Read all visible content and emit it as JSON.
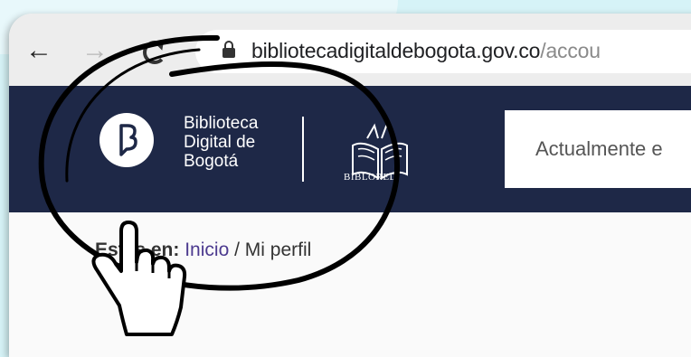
{
  "browser": {
    "url_domain": "bibliotecadigitaldebogota.gov.co",
    "url_path": "/accou"
  },
  "header": {
    "logo_lines": [
      "Biblioteca",
      "Digital de",
      "Bogotá"
    ],
    "partner_label": "BIBLORED",
    "search_placeholder": "Actualmente e"
  },
  "breadcrumb": {
    "label": "Estás en:",
    "home": "Inicio",
    "separator": " / ",
    "current": "Mi perfil"
  },
  "colors": {
    "header_bg": "#1e2847",
    "link": "#4c3a8f"
  }
}
